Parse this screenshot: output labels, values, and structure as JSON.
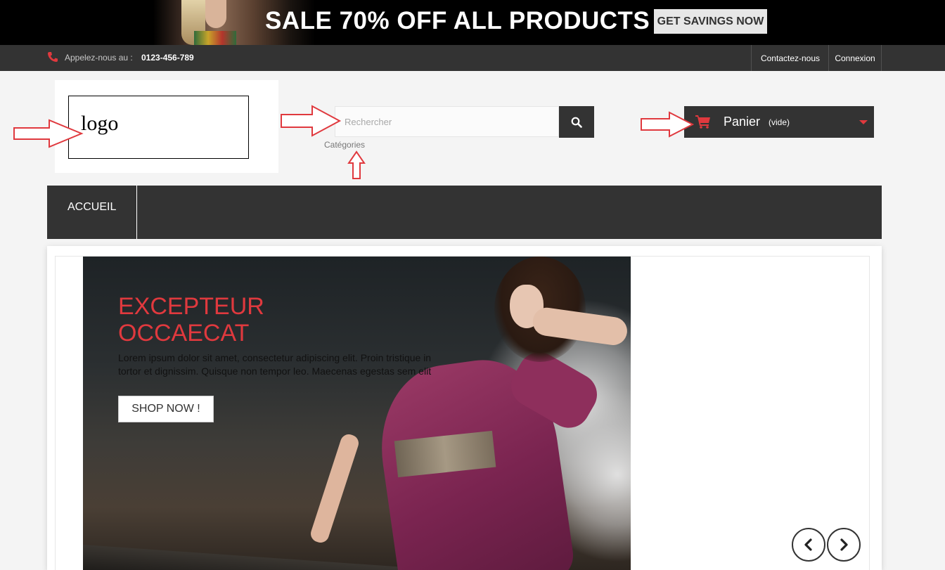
{
  "promo": {
    "title": "SALE 70% OFF ALL PRODUCTS",
    "button_label": "GET SAVINGS NOW"
  },
  "topnav": {
    "phone_label": "Appelez-nous au :",
    "phone_number": "0123-456-789",
    "contact_label": "Contactez-nous",
    "login_label": "Connexion"
  },
  "header": {
    "logo_text": "logo",
    "search_placeholder": "Rechercher",
    "categories_label": "Catégories",
    "cart_label": "Panier",
    "cart_status": "(vide)"
  },
  "menu": {
    "home_label": "ACCUEIL"
  },
  "slider": {
    "title": "EXCEPTEUR OCCAECAT",
    "text": "Lorem ipsum dolor sit amet, consectetur adipiscing elit. Proin tristique in tortor et dignissim. Quisque non tempor leo. Maecenas egestas sem elit",
    "button_label": "SHOP NOW !"
  },
  "colors": {
    "accent": "#e0393e",
    "dark": "#333333",
    "annotation_arrow": "#e0393e"
  },
  "icons": [
    "phone-icon",
    "search-icon",
    "cart-icon",
    "caret-down-icon",
    "chevron-left-icon",
    "chevron-right-icon",
    "annotation-arrow-icon"
  ]
}
